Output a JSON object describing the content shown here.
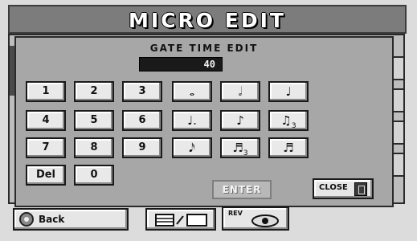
{
  "header": {
    "title": "MICRO EDIT"
  },
  "dialog": {
    "title": "GATE TIME EDIT",
    "value": "40",
    "keypad": {
      "row1": [
        "1",
        "2",
        "3"
      ],
      "row2": [
        "4",
        "5",
        "6"
      ],
      "row3": [
        "7",
        "8",
        "9"
      ],
      "row4": [
        "Del",
        "0"
      ]
    },
    "note_buttons": [
      "whole-note",
      "half-note",
      "quarter-note",
      "dotted-quarter-note",
      "eighth-note",
      "eighth-triplet-note",
      "sixteenth-note",
      "sixteenth-triplet-note",
      "thirty-second-note"
    ],
    "triplet_mark": "3",
    "enter_label": "ENTER",
    "close_label": "CLOSE"
  },
  "footer": {
    "back_label": "Back",
    "rev_label": "REV"
  },
  "colors": {
    "title_bg": "#7c7c7c",
    "dialog_bg": "#a7a7a7",
    "button_bg": "#e9e9e9",
    "value_bg": "#1a1a1a"
  }
}
